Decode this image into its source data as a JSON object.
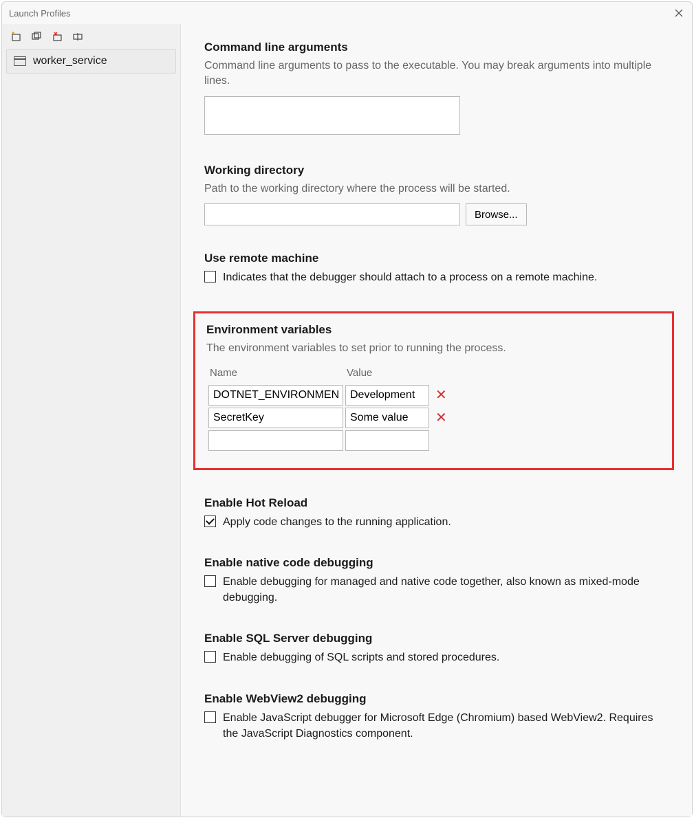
{
  "window": {
    "title": "Launch Profiles"
  },
  "sidebar": {
    "profiles": [
      {
        "label": "worker_service"
      }
    ]
  },
  "sections": {
    "cmdline": {
      "title": "Command line arguments",
      "desc": "Command line arguments to pass to the executable. You may break arguments into multiple lines.",
      "value": ""
    },
    "workdir": {
      "title": "Working directory",
      "desc": "Path to the working directory where the process will be started.",
      "value": "",
      "browse": "Browse..."
    },
    "remote": {
      "title": "Use remote machine",
      "label": "Indicates that the debugger should attach to a process on a remote machine.",
      "checked": false
    },
    "env": {
      "title": "Environment variables",
      "desc": "The environment variables to set prior to running the process.",
      "header_name": "Name",
      "header_value": "Value",
      "rows": [
        {
          "name": "DOTNET_ENVIRONMENT",
          "value": "Development"
        },
        {
          "name": "SecretKey",
          "value": "Some value"
        },
        {
          "name": "",
          "value": ""
        }
      ]
    },
    "hotreload": {
      "title": "Enable Hot Reload",
      "label": "Apply code changes to the running application.",
      "checked": true
    },
    "native": {
      "title": "Enable native code debugging",
      "label": "Enable debugging for managed and native code together, also known as mixed-mode debugging.",
      "checked": false
    },
    "sql": {
      "title": "Enable SQL Server debugging",
      "label": "Enable debugging of SQL scripts and stored procedures.",
      "checked": false
    },
    "webview2": {
      "title": "Enable WebView2 debugging",
      "label": "Enable JavaScript debugger for Microsoft Edge (Chromium) based WebView2. Requires the JavaScript Diagnostics component.",
      "checked": false
    }
  }
}
